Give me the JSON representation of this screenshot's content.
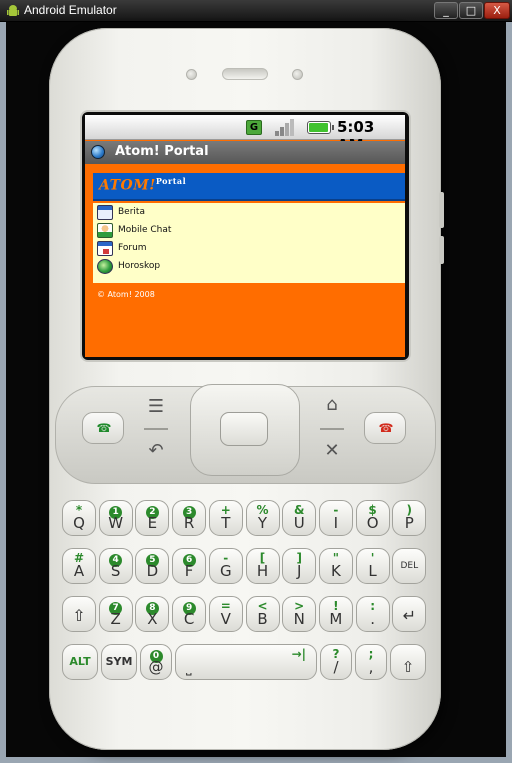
{
  "window": {
    "title": "Android Emulator",
    "controls": {
      "minimize": "_",
      "maximize": "□",
      "close": "X"
    }
  },
  "status_bar": {
    "network_label": "G",
    "time": "5:03 AM",
    "icons": [
      "signal-g-icon",
      "signal-bars-icon",
      "battery-icon"
    ]
  },
  "app": {
    "title": "Atom! Portal",
    "logo_text": "ATOM!",
    "logo_sup": "Portal",
    "menu": [
      {
        "label": "Berita",
        "icon": "news-icon"
      },
      {
        "label": "Mobile Chat",
        "icon": "chat-icon"
      },
      {
        "label": "Forum",
        "icon": "forum-icon"
      },
      {
        "label": "Horoskop",
        "icon": "horoscope-icon"
      }
    ],
    "footer": "© Atom! 2008",
    "colors": {
      "page_bg": "#ff6d00",
      "banner": "#0a5bc4",
      "menu_bg": "#ffffc8",
      "appbar": "#656565"
    }
  },
  "controls": {
    "call_icon": "☎",
    "end_icon": "☎",
    "menu_icon": "☰",
    "back_icon": "↶",
    "home_icon": "⌂",
    "search_icon": "✕"
  },
  "keyboard": {
    "row1": [
      {
        "main": "Q",
        "alt": "*",
        "badge": false
      },
      {
        "main": "W",
        "alt": "1",
        "badge": true
      },
      {
        "main": "E",
        "alt": "2",
        "badge": true
      },
      {
        "main": "R",
        "alt": "3",
        "badge": true
      },
      {
        "main": "T",
        "alt": "+",
        "badge": false
      },
      {
        "main": "Y",
        "alt": "%",
        "badge": false
      },
      {
        "main": "U",
        "alt": "&",
        "badge": false
      },
      {
        "main": "I",
        "alt": "-",
        "badge": false
      },
      {
        "main": "O",
        "alt": "$",
        "badge": false
      },
      {
        "main": "P",
        "alt": ")",
        "badge": false
      }
    ],
    "row2": [
      {
        "main": "A",
        "alt": "#",
        "badge": false
      },
      {
        "main": "S",
        "alt": "4",
        "badge": true
      },
      {
        "main": "D",
        "alt": "5",
        "badge": true
      },
      {
        "main": "F",
        "alt": "6",
        "badge": true
      },
      {
        "main": "G",
        "alt": "-",
        "badge": false
      },
      {
        "main": "H",
        "alt": "[",
        "badge": false
      },
      {
        "main": "J",
        "alt": "]",
        "badge": false
      },
      {
        "main": "K",
        "alt": "\"",
        "badge": false
      },
      {
        "main": "L",
        "alt": "'",
        "badge": false
      },
      {
        "main": "DEL",
        "alt": "",
        "badge": false
      }
    ],
    "row3": [
      {
        "main": "⇧",
        "alt": "",
        "badge": false
      },
      {
        "main": "Z",
        "alt": "7",
        "badge": true
      },
      {
        "main": "X",
        "alt": "8",
        "badge": true
      },
      {
        "main": "C",
        "alt": "9",
        "badge": true
      },
      {
        "main": "V",
        "alt": "=",
        "badge": false
      },
      {
        "main": "B",
        "alt": "<",
        "badge": false
      },
      {
        "main": "N",
        "alt": ">",
        "badge": false
      },
      {
        "main": "M",
        "alt": "!",
        "badge": false
      },
      {
        "main": ".",
        "alt": ":",
        "badge": false
      },
      {
        "main": "↵",
        "alt": "",
        "badge": false
      }
    ],
    "row4": {
      "alt_key": "ALT",
      "sym_key": "SYM",
      "at_key": "@",
      "at_alt": "0",
      "space_key": "⎵",
      "space_alt": "→|",
      "slash_key": "/",
      "slash_alt": "?",
      "comma_key": ",",
      "comma_alt": ";",
      "shift_key": "⇧"
    }
  }
}
